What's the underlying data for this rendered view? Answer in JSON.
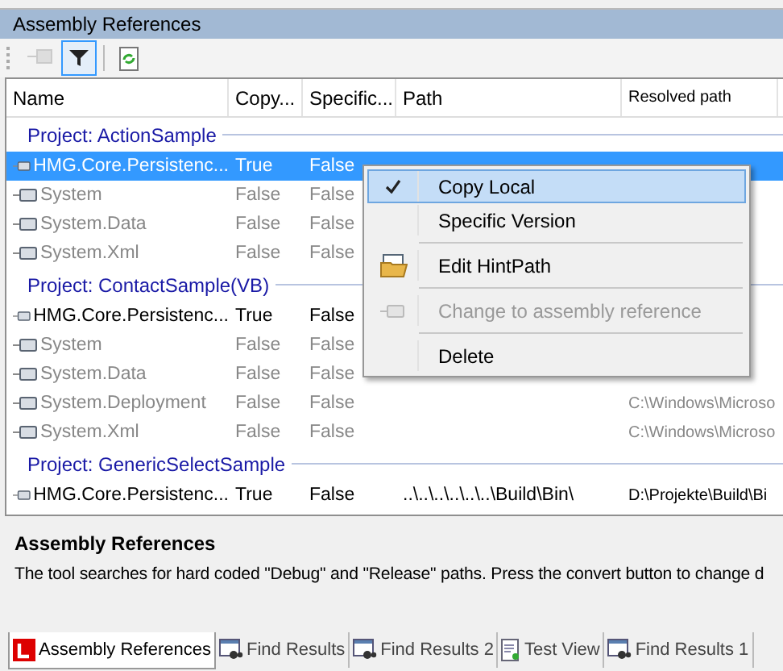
{
  "panel_title": "Assembly References",
  "toolbar": [
    {
      "kind": "reference",
      "on": false,
      "disabled": true
    },
    {
      "kind": "filter",
      "on": true,
      "disabled": false
    },
    {
      "kind": "refresh",
      "on": false,
      "disabled": false
    }
  ],
  "columns": [
    "Name",
    "Copy...",
    "Specific...",
    "Path",
    "Resolved path"
  ],
  "groups": [
    {
      "title": "Project: ActionSample",
      "rows": [
        {
          "name": "HMG.Core.Persistenc...",
          "copy": "True",
          "specific": "False",
          "dimmed": false,
          "selected": true
        },
        {
          "name": "System",
          "copy": "False",
          "specific": "False",
          "dimmed": true,
          "selected": false
        },
        {
          "name": "System.Data",
          "copy": "False",
          "specific": "False",
          "dimmed": true,
          "selected": false
        },
        {
          "name": "System.Xml",
          "copy": "False",
          "specific": "False",
          "dimmed": true,
          "selected": false
        }
      ]
    },
    {
      "title": "Project: ContactSample(VB)",
      "rows": [
        {
          "name": "HMG.Core.Persistenc...",
          "copy": "True",
          "specific": "False",
          "dimmed": false,
          "selected": false
        },
        {
          "name": "System",
          "copy": "False",
          "specific": "False",
          "dimmed": true,
          "selected": false
        },
        {
          "name": "System.Data",
          "copy": "False",
          "specific": "False",
          "dimmed": true,
          "selected": false
        },
        {
          "name": "System.Deployment",
          "copy": "False",
          "specific": "False",
          "resolved": "C:\\Windows\\Microso",
          "dimmed": true,
          "selected": false
        },
        {
          "name": "System.Xml",
          "copy": "False",
          "specific": "False",
          "resolved": "C:\\Windows\\Microso",
          "dimmed": true,
          "selected": false
        }
      ]
    },
    {
      "title": "Project: GenericSelectSample",
      "rows": [
        {
          "name": "HMG.Core.Persistenc...",
          "copy": "True",
          "specific": "False",
          "path": "..\\..\\..\\..\\..\\..\\Build\\Bin\\",
          "resolved": "D:\\Projekte\\Build\\Bi",
          "dimmed": false,
          "selected": false
        }
      ]
    }
  ],
  "context_menu": [
    {
      "label": "Copy Local",
      "kind": "plain",
      "checked": true,
      "selected": true,
      "disabled": false,
      "separator_before": false
    },
    {
      "label": "Specific Version",
      "kind": "plain",
      "checked": false,
      "selected": false,
      "disabled": false,
      "separator_before": false
    },
    {
      "label": "Edit HintPath",
      "kind": "folder",
      "selected": false,
      "disabled": false,
      "separator_before": true
    },
    {
      "label": "Change to assembly reference",
      "kind": "reference",
      "selected": false,
      "disabled": true,
      "separator_before": true
    },
    {
      "label": "Delete",
      "kind": "plain",
      "checked": false,
      "selected": false,
      "disabled": false,
      "separator_before": true
    }
  ],
  "description": {
    "title": "Assembly References",
    "text": "The tool searches for hard coded \"Debug\" and \"Release\" paths. Press the convert button to change d"
  },
  "tabs": [
    {
      "label": "Assembly References",
      "kind": "logo",
      "selected": true
    },
    {
      "label": "Find Results",
      "kind": "find",
      "selected": false
    },
    {
      "label": "Find Results 2",
      "kind": "find",
      "selected": false
    },
    {
      "label": "Test View",
      "kind": "doc",
      "selected": false
    },
    {
      "label": "Find Results 1",
      "kind": "find",
      "selected": false
    }
  ]
}
